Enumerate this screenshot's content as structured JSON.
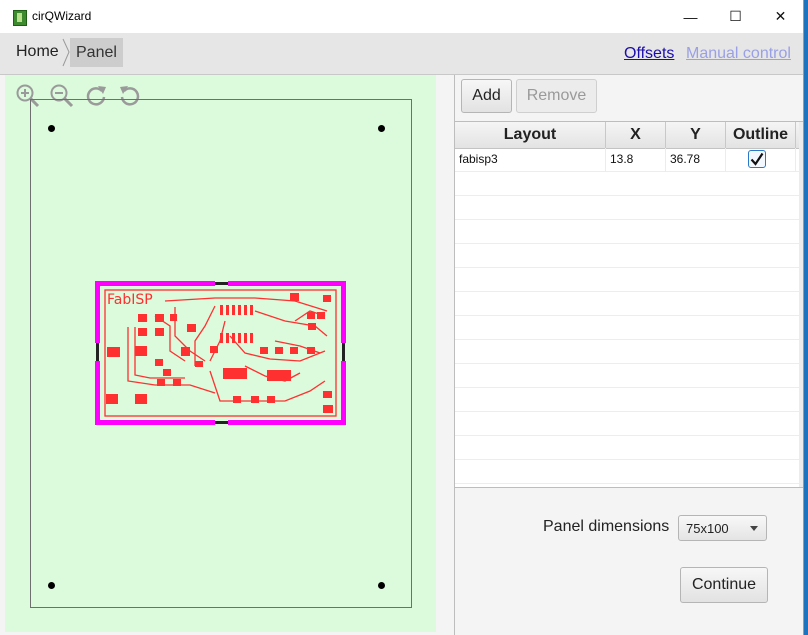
{
  "window": {
    "title": "cirQWizard",
    "minimize": "—",
    "maximize": "☐",
    "close": "✕"
  },
  "breadcrumb": {
    "home": "Home",
    "panel": "Panel"
  },
  "links": {
    "offsets": "Offsets",
    "manual_control": "Manual control"
  },
  "canvas": {
    "tools": [
      "zoom-in-icon",
      "zoom-out-icon",
      "rotate-cw-icon",
      "rotate-ccw-icon"
    ],
    "pcb_label": "FabISP",
    "colors": {
      "background": "#dcfadc",
      "trace": "#ff3030",
      "border": "#ff00ff"
    }
  },
  "buttons": {
    "add": "Add",
    "remove": "Remove",
    "continue": "Continue"
  },
  "table": {
    "columns": [
      "Layout",
      "X",
      "Y",
      "Outline"
    ],
    "rows": [
      {
        "layout": "fabisp3",
        "x": "13.8",
        "y": "36.78",
        "outline": true
      }
    ]
  },
  "panel_dimensions": {
    "label": "Panel dimensions",
    "value": "75x100"
  }
}
